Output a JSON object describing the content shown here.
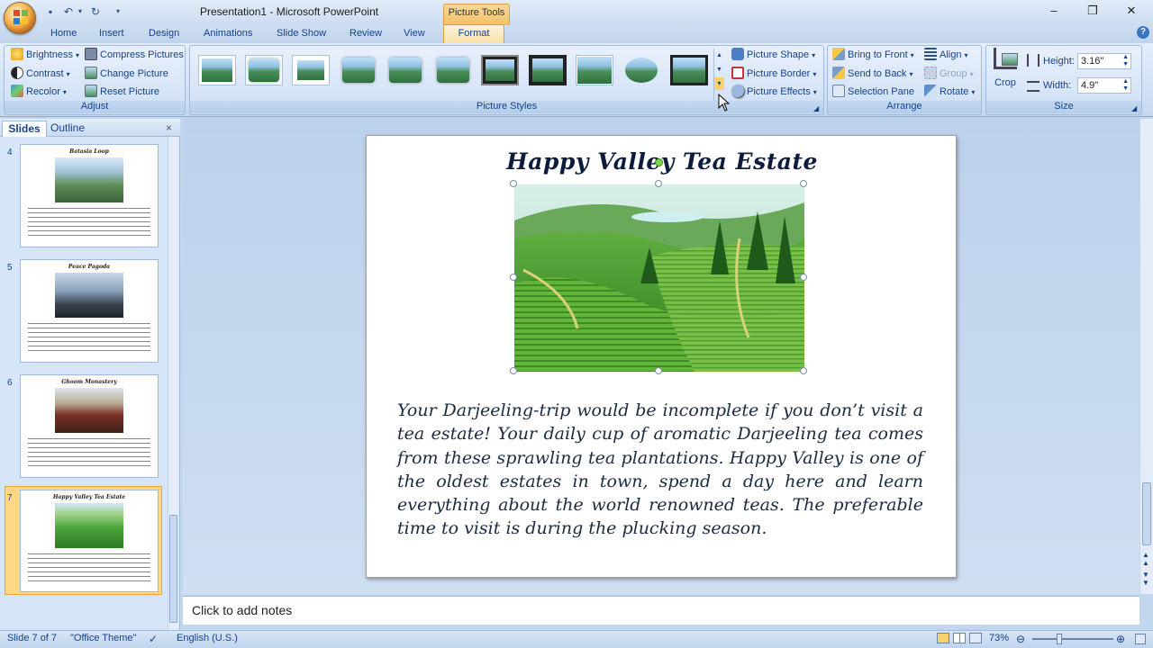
{
  "title_bar": {
    "app_title": "Presentation1 - Microsoft PowerPoint",
    "context_tab_title": "Picture Tools"
  },
  "tabs": [
    "Home",
    "Insert",
    "Design",
    "Animations",
    "Slide Show",
    "Review",
    "View"
  ],
  "active_tab": "Format",
  "ribbon": {
    "adjust": {
      "label": "Adjust",
      "brightness": "Brightness",
      "contrast": "Contrast",
      "recolor": "Recolor",
      "compress": "Compress Pictures",
      "change": "Change Picture",
      "reset": "Reset Picture"
    },
    "picture_styles": {
      "label": "Picture Styles",
      "shape": "Picture Shape",
      "border": "Picture Border",
      "effects": "Picture Effects"
    },
    "arrange": {
      "label": "Arrange",
      "bring_front": "Bring to Front",
      "send_back": "Send to Back",
      "selection_pane": "Selection Pane",
      "align": "Align",
      "group": "Group",
      "rotate": "Rotate"
    },
    "size": {
      "label": "Size",
      "crop": "Crop",
      "height_label": "Height:",
      "height_value": "3.16\"",
      "width_label": "Width:",
      "width_value": "4.9\""
    }
  },
  "panel": {
    "tab_slides": "Slides",
    "tab_outline": "Outline",
    "close": "×",
    "slides": [
      {
        "num": "4",
        "title": "Batasia Loop"
      },
      {
        "num": "5",
        "title": "Peace Pagoda"
      },
      {
        "num": "6",
        "title": "Ghoom Monastery"
      },
      {
        "num": "7",
        "title": "Happy Valley Tea Estate"
      }
    ]
  },
  "slide": {
    "title": "Happy Valley Tea Estate",
    "body": "Your Darjeeling-trip would be incomplete if you don’t visit a tea estate! Your daily cup of aromatic Darjeeling tea comes from these sprawling tea plantations. Happy Valley is one of the oldest estates in town, spend a day here and learn everything about the world renowned teas. The preferable time to visit is during the plucking season."
  },
  "notes_placeholder": "Click to add notes",
  "status": {
    "slide_info": "Slide 7 of 7",
    "theme": "\"Office Theme\"",
    "language": "English (U.S.)",
    "zoom": "73%"
  }
}
